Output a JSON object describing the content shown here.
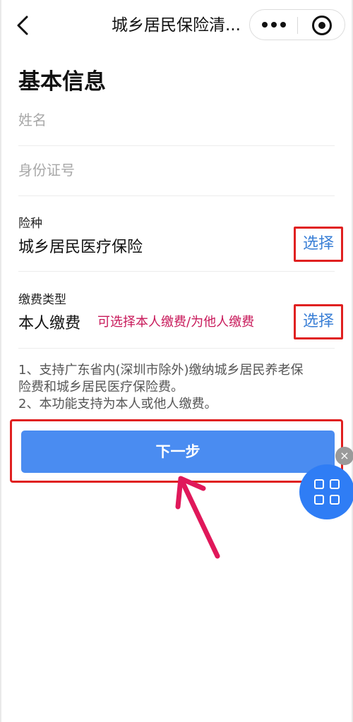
{
  "nav": {
    "title": "城乡居民保险清...",
    "icons": [
      "back-chevron-icon",
      "more-dots-icon",
      "target-icon"
    ]
  },
  "page": {
    "title": "基本信息"
  },
  "form": {
    "name_placeholder": "姓名",
    "id_placeholder": "身份证号",
    "insurance_label": "险种",
    "insurance_value": "城乡居民医疗保险",
    "insurance_select": "选择",
    "payment_label": "缴费类型",
    "payment_value": "本人缴费",
    "payment_hint": "可选择本人缴费/为他人缴费",
    "payment_select": "选择"
  },
  "notes": {
    "line1": "1、支持广东省内(深圳市除外)缴纳城乡居民养老保",
    "line2": "险费和城乡居民医疗保险费。",
    "line3": "2、本功能支持为本人或他人缴费。"
  },
  "actions": {
    "next_label": "下一步"
  },
  "floating": {
    "close_label": "×"
  },
  "colors": {
    "primary": "#4a8cf1",
    "highlight_box": "#e02020",
    "hint_text": "#c8195a",
    "arrow": "#e0185a",
    "link": "#3a7fd6"
  }
}
